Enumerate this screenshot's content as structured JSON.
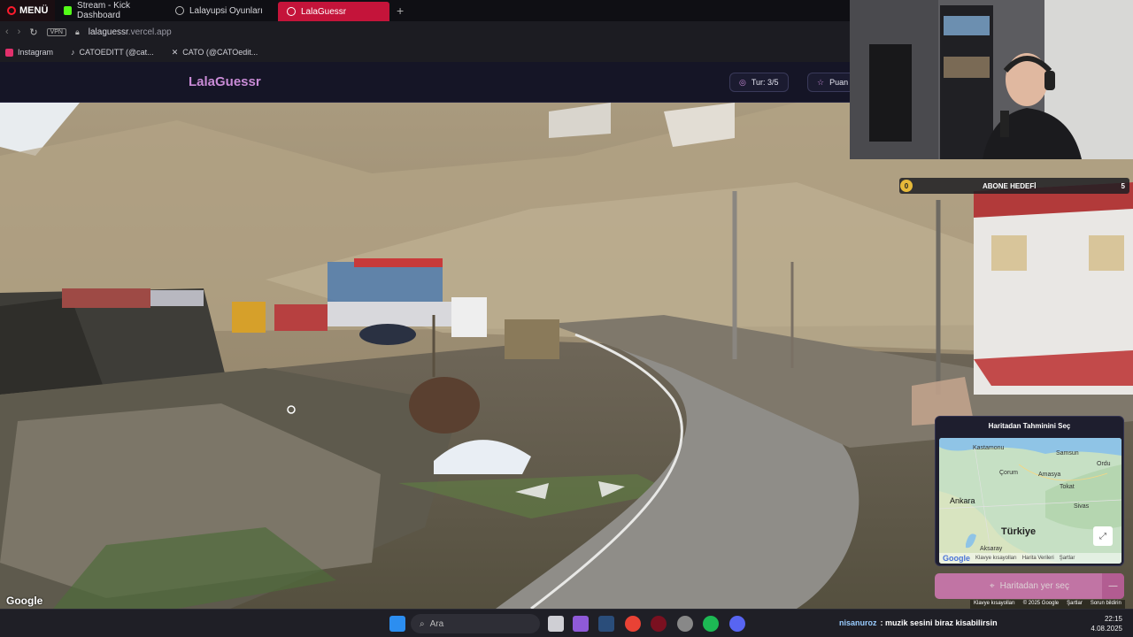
{
  "browser": {
    "menu_label": "MENÜ",
    "tabs": [
      {
        "label": "Stream - Kick Dashboard",
        "color": "#53fc18"
      },
      {
        "label": "Lalayupsi Oyunları",
        "color": "#bbbbbb"
      },
      {
        "label": "LalaGuessr",
        "color": "#ffffff"
      }
    ],
    "new_tab": "+",
    "vpn_label": "VPN",
    "url_host": "lalaguessr",
    "url_rest": ".vercel.app",
    "bookmarks": [
      {
        "label": "Instagram",
        "color": "#e1306c"
      },
      {
        "label": "CATOEDITT (@cat...",
        "color": "#ffffff"
      },
      {
        "label": "CATO (@CATOedit...",
        "color": "#ffffff"
      }
    ]
  },
  "app": {
    "brand": "LalaGuessr",
    "round_label": "Tur: 3/5",
    "score_label": "Puan",
    "accent": "#c98bd6"
  },
  "overlay": {
    "goal_current": "0",
    "goal_title": "ABONE HEDEFİ",
    "goal_target": "5"
  },
  "map": {
    "title": "Haritadan Tahminini Seç",
    "labels": [
      "Kastamonu",
      "Samsun",
      "Ordu",
      "Çorum",
      "Amasya",
      "Tokat",
      "Ankara",
      "Sivas",
      "Türkiye",
      "Aksaray"
    ],
    "footer": [
      "Klavye kısayolları",
      "Harita Verileri",
      "Şartlar"
    ],
    "google": "Google",
    "guess_button": "Haritadan yer seç"
  },
  "streetview": {
    "google": "Google",
    "footer": [
      "Klavye kısayolları",
      "© 2025 Google",
      "Şartlar",
      "Sorun bildirin"
    ]
  },
  "taskbar": {
    "search_placeholder": "Ara",
    "chat_user": "nisanuroz",
    "chat_message": ": muzik sesini biraz kisabilirsin",
    "time": "22:15",
    "date": "4.08.2025"
  }
}
